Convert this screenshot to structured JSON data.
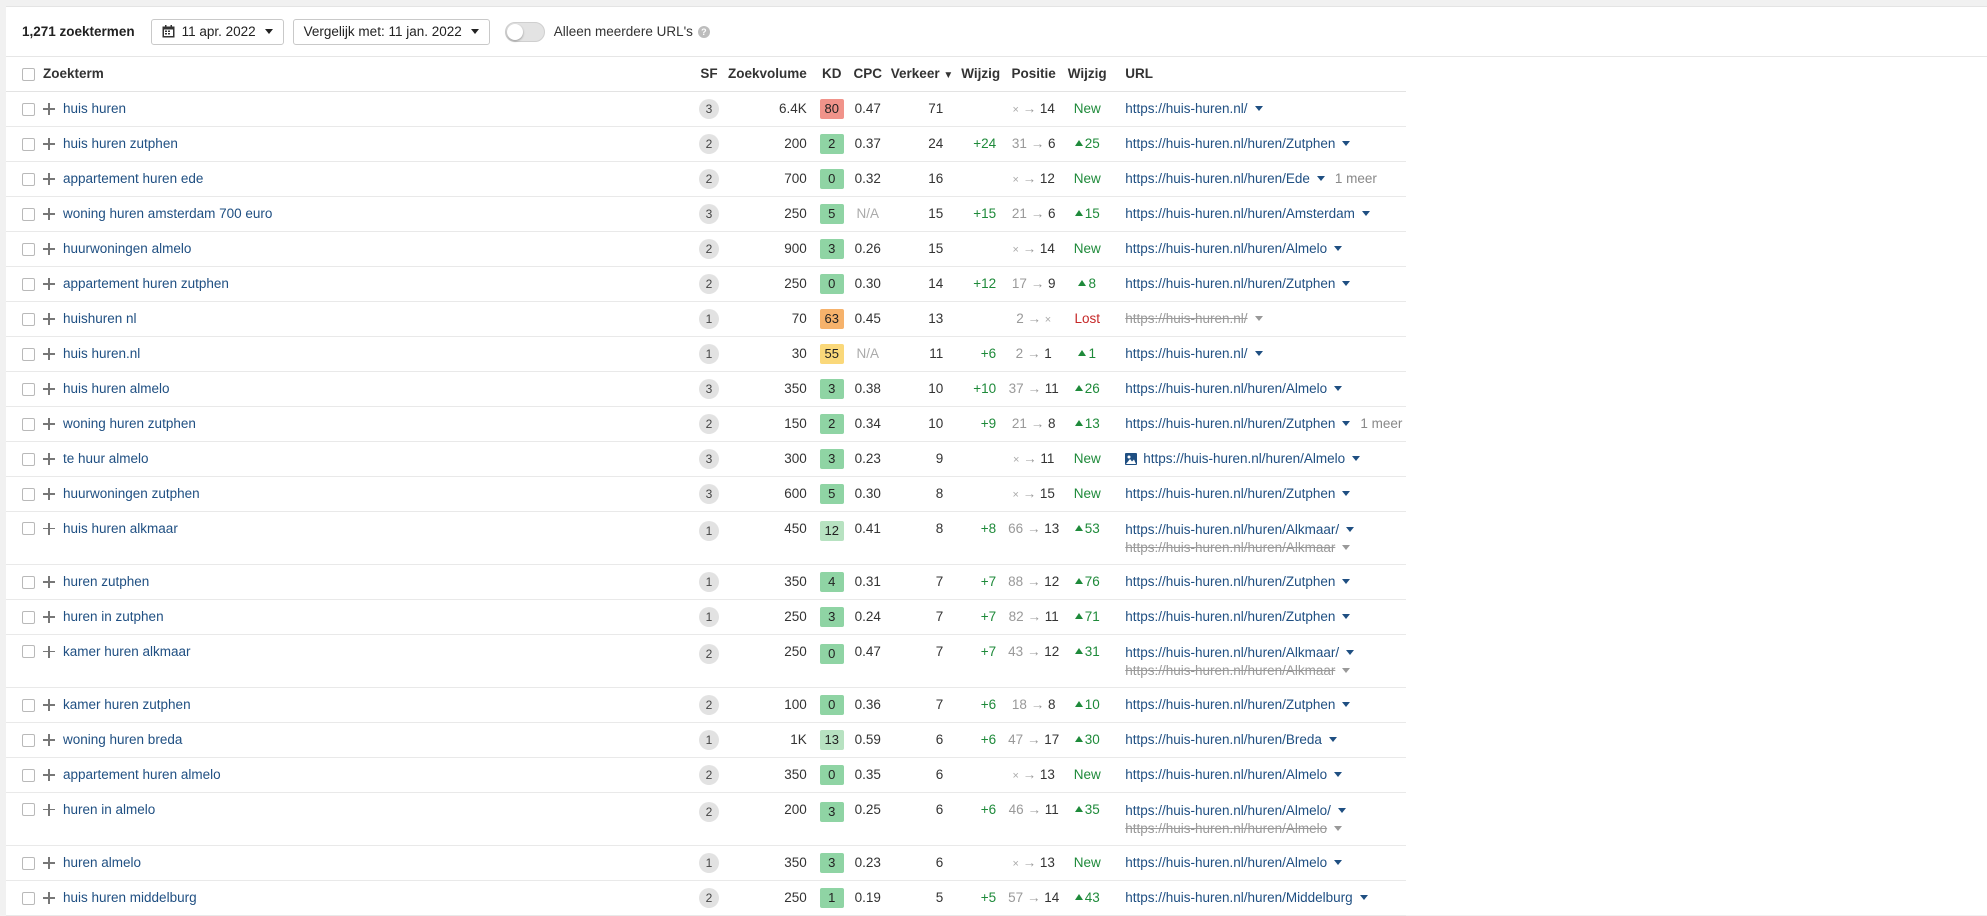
{
  "toolbar": {
    "count": "1,271 zoekterm",
    "count_suffix": "en",
    "date": "11 apr. 2022",
    "compare": "Vergelijk met: 11 jan. 2022",
    "toggle_label": "Alleen meerdere URL's",
    "help": "?"
  },
  "columns": {
    "keyword": "Zoekterm",
    "sf": "SF",
    "volume": "Zoekvolume",
    "kd": "KD",
    "cpc": "CPC",
    "traffic": "Verkeer",
    "traffic_change": "Wijzig",
    "position": "Positie",
    "position_change": "Wijzig",
    "url": "URL"
  },
  "colors": {
    "kd_red": "#f1938a",
    "kd_orange": "#f6b26b",
    "kd_yellow": "#fad87a",
    "kd_green": "#8fd4a4",
    "kd_lightgreen": "#b7e2c1",
    "link": "#1f4f82",
    "positive": "#1e8a3a",
    "negative": "#c62828"
  },
  "rows": [
    {
      "kw": "huis huren",
      "sf": "3",
      "vol": "6.4K",
      "kd": "80",
      "kdc": "#f1938a",
      "cpc": "0.47",
      "na": false,
      "traffic": "71",
      "dtraffic": "",
      "from": "×",
      "to": "14",
      "dpos": "New",
      "dtype": "new",
      "urls": [
        {
          "u": "https://huis-huren.nl/",
          "old": false
        }
      ],
      "more": "",
      "img": false
    },
    {
      "kw": "huis huren zutphen",
      "sf": "2",
      "vol": "200",
      "kd": "2",
      "kdc": "#8fd4a4",
      "cpc": "0.37",
      "na": false,
      "traffic": "24",
      "dtraffic": "+24",
      "from": "31",
      "to": "6",
      "dpos": "25",
      "dtype": "up",
      "urls": [
        {
          "u": "https://huis-huren.nl/huren/Zutphen",
          "old": false
        }
      ],
      "more": "",
      "img": false
    },
    {
      "kw": "appartement huren ede",
      "sf": "2",
      "vol": "700",
      "kd": "0",
      "kdc": "#8fd4a4",
      "cpc": "0.32",
      "na": false,
      "traffic": "16",
      "dtraffic": "",
      "from": "×",
      "to": "12",
      "dpos": "New",
      "dtype": "new",
      "urls": [
        {
          "u": "https://huis-huren.nl/huren/Ede",
          "old": false
        }
      ],
      "more": "1 meer",
      "img": false
    },
    {
      "kw": "woning huren amsterdam 700 euro",
      "sf": "3",
      "vol": "250",
      "kd": "5",
      "kdc": "#8fd4a4",
      "cpc": "N/A",
      "na": true,
      "traffic": "15",
      "dtraffic": "+15",
      "from": "21",
      "to": "6",
      "dpos": "15",
      "dtype": "up",
      "urls": [
        {
          "u": "https://huis-huren.nl/huren/Amsterdam",
          "old": false
        }
      ],
      "more": "",
      "img": false
    },
    {
      "kw": "huurwoningen almelo",
      "sf": "2",
      "vol": "900",
      "kd": "3",
      "kdc": "#8fd4a4",
      "cpc": "0.26",
      "na": false,
      "traffic": "15",
      "dtraffic": "",
      "from": "×",
      "to": "14",
      "dpos": "New",
      "dtype": "new",
      "urls": [
        {
          "u": "https://huis-huren.nl/huren/Almelo",
          "old": false
        }
      ],
      "more": "",
      "img": false
    },
    {
      "kw": "appartement huren zutphen",
      "sf": "2",
      "vol": "250",
      "kd": "0",
      "kdc": "#8fd4a4",
      "cpc": "0.30",
      "na": false,
      "traffic": "14",
      "dtraffic": "+12",
      "from": "17",
      "to": "9",
      "dpos": "8",
      "dtype": "up",
      "urls": [
        {
          "u": "https://huis-huren.nl/huren/Zutphen",
          "old": false
        }
      ],
      "more": "",
      "img": false
    },
    {
      "kw": "huishuren nl",
      "sf": "1",
      "vol": "70",
      "kd": "63",
      "kdc": "#f6b26b",
      "cpc": "0.45",
      "na": false,
      "traffic": "13",
      "dtraffic": "",
      "from": "2",
      "to": "×",
      "dpos": "Lost",
      "dtype": "lost",
      "urls": [
        {
          "u": "https://huis-huren.nl/",
          "old": true
        }
      ],
      "more": "",
      "img": false
    },
    {
      "kw": "huis huren.nl",
      "sf": "1",
      "vol": "30",
      "kd": "55",
      "kdc": "#fad87a",
      "cpc": "N/A",
      "na": true,
      "traffic": "11",
      "dtraffic": "+6",
      "from": "2",
      "to": "1",
      "dpos": "1",
      "dtype": "up",
      "urls": [
        {
          "u": "https://huis-huren.nl/",
          "old": false
        }
      ],
      "more": "",
      "img": false
    },
    {
      "kw": "huis huren almelo",
      "sf": "3",
      "vol": "350",
      "kd": "3",
      "kdc": "#8fd4a4",
      "cpc": "0.38",
      "na": false,
      "traffic": "10",
      "dtraffic": "+10",
      "from": "37",
      "to": "11",
      "dpos": "26",
      "dtype": "up",
      "urls": [
        {
          "u": "https://huis-huren.nl/huren/Almelo",
          "old": false
        }
      ],
      "more": "",
      "img": false
    },
    {
      "kw": "woning huren zutphen",
      "sf": "2",
      "vol": "150",
      "kd": "2",
      "kdc": "#8fd4a4",
      "cpc": "0.34",
      "na": false,
      "traffic": "10",
      "dtraffic": "+9",
      "from": "21",
      "to": "8",
      "dpos": "13",
      "dtype": "up",
      "urls": [
        {
          "u": "https://huis-huren.nl/huren/Zutphen",
          "old": false
        }
      ],
      "more": "1 meer",
      "img": false
    },
    {
      "kw": "te huur almelo",
      "sf": "3",
      "vol": "300",
      "kd": "3",
      "kdc": "#8fd4a4",
      "cpc": "0.23",
      "na": false,
      "traffic": "9",
      "dtraffic": "",
      "from": "×",
      "to": "11",
      "dpos": "New",
      "dtype": "new",
      "urls": [
        {
          "u": "https://huis-huren.nl/huren/Almelo",
          "old": false
        }
      ],
      "more": "",
      "img": true
    },
    {
      "kw": "huurwoningen zutphen",
      "sf": "3",
      "vol": "600",
      "kd": "5",
      "kdc": "#8fd4a4",
      "cpc": "0.30",
      "na": false,
      "traffic": "8",
      "dtraffic": "",
      "from": "×",
      "to": "15",
      "dpos": "New",
      "dtype": "new",
      "urls": [
        {
          "u": "https://huis-huren.nl/huren/Zutphen",
          "old": false
        }
      ],
      "more": "",
      "img": false
    },
    {
      "kw": "huis huren alkmaar",
      "sf": "1",
      "vol": "450",
      "kd": "12",
      "kdc": "#b7e2c1",
      "cpc": "0.41",
      "na": false,
      "traffic": "8",
      "dtraffic": "+8",
      "from": "66",
      "to": "13",
      "dpos": "53",
      "dtype": "up",
      "urls": [
        {
          "u": "https://huis-huren.nl/huren/Alkmaar/",
          "old": false
        },
        {
          "u": "https://huis-huren.nl/huren/Alkmaar",
          "old": true
        }
      ],
      "more": "",
      "img": false
    },
    {
      "kw": "huren zutphen",
      "sf": "1",
      "vol": "350",
      "kd": "4",
      "kdc": "#8fd4a4",
      "cpc": "0.31",
      "na": false,
      "traffic": "7",
      "dtraffic": "+7",
      "from": "88",
      "to": "12",
      "dpos": "76",
      "dtype": "up",
      "urls": [
        {
          "u": "https://huis-huren.nl/huren/Zutphen",
          "old": false
        }
      ],
      "more": "",
      "img": false
    },
    {
      "kw": "huren in zutphen",
      "sf": "1",
      "vol": "250",
      "kd": "3",
      "kdc": "#8fd4a4",
      "cpc": "0.24",
      "na": false,
      "traffic": "7",
      "dtraffic": "+7",
      "from": "82",
      "to": "11",
      "dpos": "71",
      "dtype": "up",
      "urls": [
        {
          "u": "https://huis-huren.nl/huren/Zutphen",
          "old": false
        }
      ],
      "more": "",
      "img": false
    },
    {
      "kw": "kamer huren alkmaar",
      "sf": "2",
      "vol": "250",
      "kd": "0",
      "kdc": "#8fd4a4",
      "cpc": "0.47",
      "na": false,
      "traffic": "7",
      "dtraffic": "+7",
      "from": "43",
      "to": "12",
      "dpos": "31",
      "dtype": "up",
      "urls": [
        {
          "u": "https://huis-huren.nl/huren/Alkmaar/",
          "old": false
        },
        {
          "u": "https://huis-huren.nl/huren/Alkmaar",
          "old": true
        }
      ],
      "more": "",
      "img": false
    },
    {
      "kw": "kamer huren zutphen",
      "sf": "2",
      "vol": "100",
      "kd": "0",
      "kdc": "#8fd4a4",
      "cpc": "0.36",
      "na": false,
      "traffic": "7",
      "dtraffic": "+6",
      "from": "18",
      "to": "8",
      "dpos": "10",
      "dtype": "up",
      "urls": [
        {
          "u": "https://huis-huren.nl/huren/Zutphen",
          "old": false
        }
      ],
      "more": "",
      "img": false
    },
    {
      "kw": "woning huren breda",
      "sf": "1",
      "vol": "1K",
      "kd": "13",
      "kdc": "#b7e2c1",
      "cpc": "0.59",
      "na": false,
      "traffic": "6",
      "dtraffic": "+6",
      "from": "47",
      "to": "17",
      "dpos": "30",
      "dtype": "up",
      "urls": [
        {
          "u": "https://huis-huren.nl/huren/Breda",
          "old": false
        }
      ],
      "more": "",
      "img": false
    },
    {
      "kw": "appartement huren almelo",
      "sf": "2",
      "vol": "350",
      "kd": "0",
      "kdc": "#8fd4a4",
      "cpc": "0.35",
      "na": false,
      "traffic": "6",
      "dtraffic": "",
      "from": "×",
      "to": "13",
      "dpos": "New",
      "dtype": "new",
      "urls": [
        {
          "u": "https://huis-huren.nl/huren/Almelo",
          "old": false
        }
      ],
      "more": "",
      "img": false
    },
    {
      "kw": "huren in almelo",
      "sf": "2",
      "vol": "200",
      "kd": "3",
      "kdc": "#8fd4a4",
      "cpc": "0.25",
      "na": false,
      "traffic": "6",
      "dtraffic": "+6",
      "from": "46",
      "to": "11",
      "dpos": "35",
      "dtype": "up",
      "urls": [
        {
          "u": "https://huis-huren.nl/huren/Almelo/",
          "old": false
        },
        {
          "u": "https://huis-huren.nl/huren/Almelo",
          "old": true
        }
      ],
      "more": "",
      "img": false
    },
    {
      "kw": "huren almelo",
      "sf": "1",
      "vol": "350",
      "kd": "3",
      "kdc": "#8fd4a4",
      "cpc": "0.23",
      "na": false,
      "traffic": "6",
      "dtraffic": "",
      "from": "×",
      "to": "13",
      "dpos": "New",
      "dtype": "new",
      "urls": [
        {
          "u": "https://huis-huren.nl/huren/Almelo",
          "old": false
        }
      ],
      "more": "",
      "img": false
    },
    {
      "kw": "huis huren middelburg",
      "sf": "2",
      "vol": "250",
      "kd": "1",
      "kdc": "#8fd4a4",
      "cpc": "0.19",
      "na": false,
      "traffic": "5",
      "dtraffic": "+5",
      "from": "57",
      "to": "14",
      "dpos": "43",
      "dtype": "up",
      "urls": [
        {
          "u": "https://huis-huren.nl/huren/Middelburg",
          "old": false
        }
      ],
      "more": "",
      "img": false
    }
  ]
}
